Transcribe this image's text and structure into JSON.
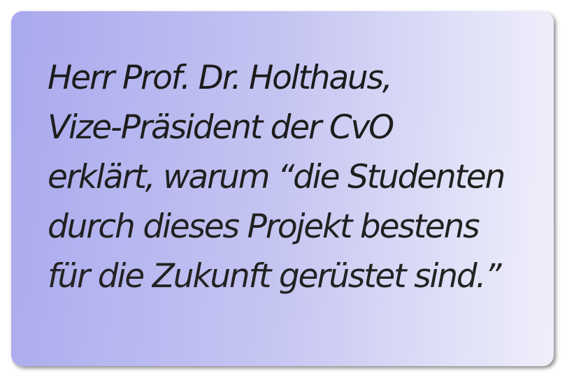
{
  "quote": {
    "lines": [
      "Herr Prof. Dr. Holthaus,",
      "Vize-Präsident der CvO",
      "erklärt, warum “die Studenten",
      "durch dieses Projekt bestens",
      "für die Zukunft gerüstet sind.”"
    ]
  },
  "colors": {
    "card_gradient_start": "#a9a9ee",
    "card_gradient_end": "#eeeefb",
    "text": "#1a1a1a"
  }
}
